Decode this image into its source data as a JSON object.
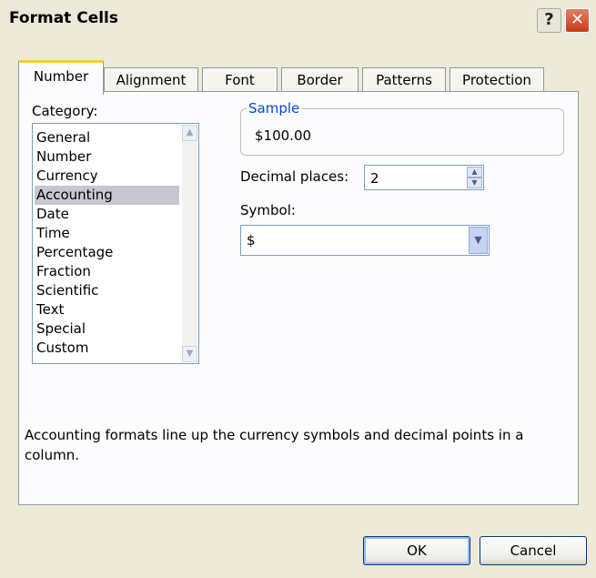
{
  "window": {
    "title": "Format Cells",
    "help_label": "?",
    "close_label": "✕"
  },
  "tabs": [
    "Number",
    "Alignment",
    "Font",
    "Border",
    "Patterns",
    "Protection"
  ],
  "number_tab": {
    "category_label": "Category:",
    "categories": [
      "General",
      "Number",
      "Currency",
      "Accounting",
      "Date",
      "Time",
      "Percentage",
      "Fraction",
      "Scientific",
      "Text",
      "Special",
      "Custom"
    ],
    "selected_category": "Accounting",
    "sample_legend": "Sample",
    "sample_value": "$100.00",
    "decimal_label": "Decimal places:",
    "decimal_value": "2",
    "symbol_label": "Symbol:",
    "symbol_value": "$",
    "description": "Accounting formats line up the currency symbols and decimal points in a column."
  },
  "buttons": {
    "ok": "OK",
    "cancel": "Cancel"
  },
  "colors": {
    "dialog_bg": "#ece9d8",
    "panel_bg": "#fcfcfe",
    "tab_highlight": "#ffc73c",
    "selection": "#c7c7d2",
    "legend_text": "#0046d5",
    "close_button": "#c83a1a"
  }
}
